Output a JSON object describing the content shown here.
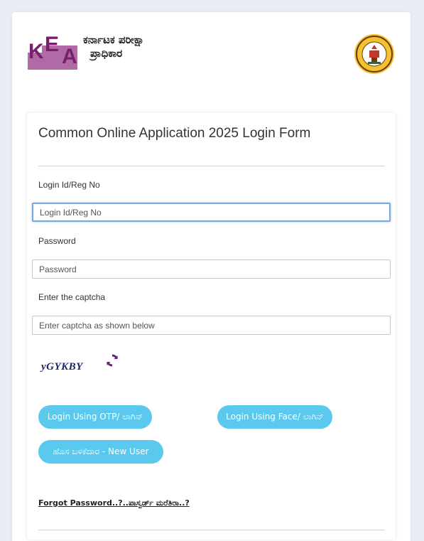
{
  "header": {
    "logo_letters": "KEA",
    "org_name_line1": "ಕರ್ನಾಟಕ ಪರೀಕ್ಷಾ",
    "org_name_line2": "ಪ್ರಾಧಿಕಾರ",
    "emblem_icon": "government-of-karnataka-emblem"
  },
  "form": {
    "title": "Common Online Application 2025 Login Form",
    "login_label": "Login Id/Reg No",
    "login_placeholder": "Login Id/Reg No",
    "password_label": "Password",
    "password_placeholder": "Password",
    "captcha_label": "Enter the captcha",
    "captcha_placeholder": "Enter captcha as shown below",
    "captcha_text": "yGYKBY",
    "refresh_icon": "refresh-icon"
  },
  "buttons": {
    "otp_login": "Login Using OTP/ ಲಾಗಿನ್",
    "face_login": "Login Using Face/ ಲಾಗಿನ್",
    "new_user": "ಹೊಸ ಬಳಕೆದಾರ - New User"
  },
  "links": {
    "forgot_password": "Forgot Password..?..ಪಾಸ್ವರ್ಡ್ ಮರೆತಿರಾ..?"
  },
  "colors": {
    "button": "#5bc8ee",
    "logo_purple": "#8b2a7e",
    "logo_block": "#b06aa6"
  }
}
